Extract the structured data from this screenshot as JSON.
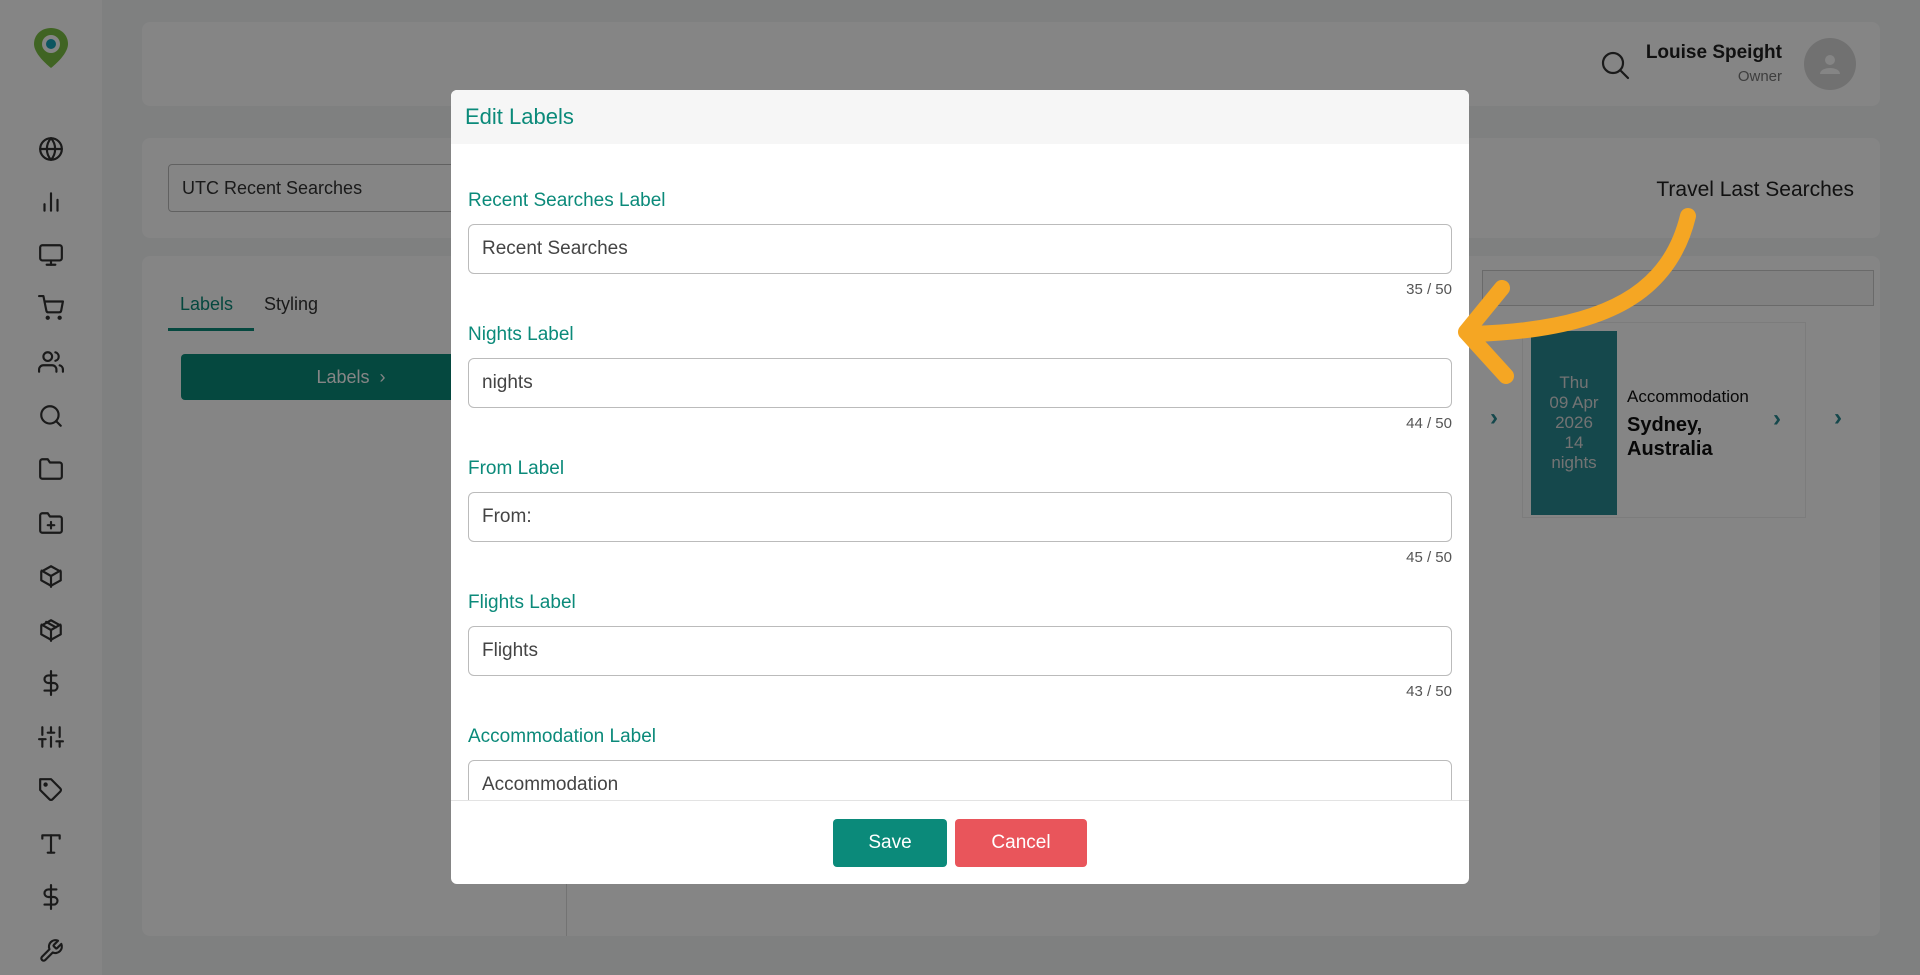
{
  "user": {
    "name": "Louise Speight",
    "role": "Owner"
  },
  "widget": {
    "select_value": "UTC Recent Searches",
    "title": "Travel Last Searches"
  },
  "tabs": [
    {
      "label": "Labels"
    },
    {
      "label": "Styling"
    }
  ],
  "labels_button": {
    "label": "Labels",
    "chevron": "›"
  },
  "preview": {
    "date_lines": [
      "Thu",
      "09 Apr",
      "2026",
      "14",
      "nights"
    ],
    "type": "Accommodation",
    "destination": "Sydney, Australia",
    "chevron": "›"
  },
  "modal": {
    "title": "Edit Labels",
    "fields": [
      {
        "label": "Recent Searches Label",
        "value": "Recent Searches",
        "count": "35 / 50"
      },
      {
        "label": "Nights Label",
        "value": "nights",
        "count": "44 / 50"
      },
      {
        "label": "From Label",
        "value": "From:",
        "count": "45 / 50"
      },
      {
        "label": "Flights Label",
        "value": "Flights",
        "count": "43 / 50"
      },
      {
        "label": "Accommodation Label",
        "value": "Accommodation",
        "count": ""
      }
    ],
    "save_label": "Save",
    "cancel_label": "Cancel"
  },
  "colors": {
    "accent": "#0b8a7a",
    "danger": "#e9555b",
    "annotation": "#f5a623"
  },
  "sidebar_icons": [
    "globe-icon",
    "bar-chart-icon",
    "monitor-icon",
    "cart-icon",
    "users-icon",
    "search-icon",
    "folder-icon",
    "folder-plus-icon",
    "box-icon",
    "package-icon",
    "dollar-icon",
    "sliders-icon",
    "tag-icon",
    "type-icon",
    "dollar-icon",
    "wrench-icon"
  ]
}
